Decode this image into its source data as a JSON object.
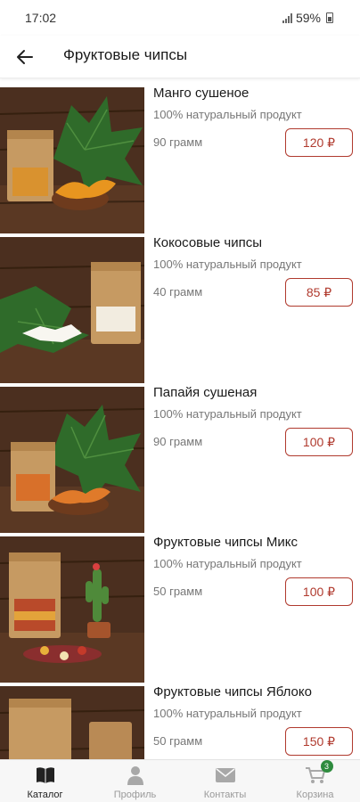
{
  "status_bar": {
    "time": "17:02",
    "battery": "59%"
  },
  "header": {
    "title": "Фруктовые чипсы",
    "back_icon": "arrow-left-icon"
  },
  "products": [
    {
      "name": "Манго сушеное",
      "description": "100% натуральный продукт",
      "weight": "90 грамм",
      "price": "120 ₽"
    },
    {
      "name": "Кокосовые чипсы",
      "description": "100% натуральный продукт",
      "weight": "40 грамм",
      "price": "85 ₽"
    },
    {
      "name": "Папайя сушеная",
      "description": "100% натуральный продукт",
      "weight": "90 грамм",
      "price": "100 ₽"
    },
    {
      "name": "Фруктовые чипсы Микс",
      "description": "100% натуральный продукт",
      "weight": "50 грамм",
      "price": "100 ₽"
    },
    {
      "name": "Фруктовые чипсы Яблоко",
      "description": "100% натуральный продукт",
      "weight": "50 грамм",
      "price": "150 ₽"
    }
  ],
  "bottom_nav": {
    "items": [
      {
        "label": "Каталог",
        "icon": "book-icon",
        "active": true
      },
      {
        "label": "Профиль",
        "icon": "person-icon",
        "active": false
      },
      {
        "label": "Контакты",
        "icon": "envelope-icon",
        "active": false
      },
      {
        "label": "Корзина",
        "icon": "cart-icon",
        "active": false,
        "badge": "3"
      }
    ]
  },
  "colors": {
    "accent": "#b03a2e",
    "badge": "#2e8b3e",
    "wood": "#4a2e1e"
  }
}
